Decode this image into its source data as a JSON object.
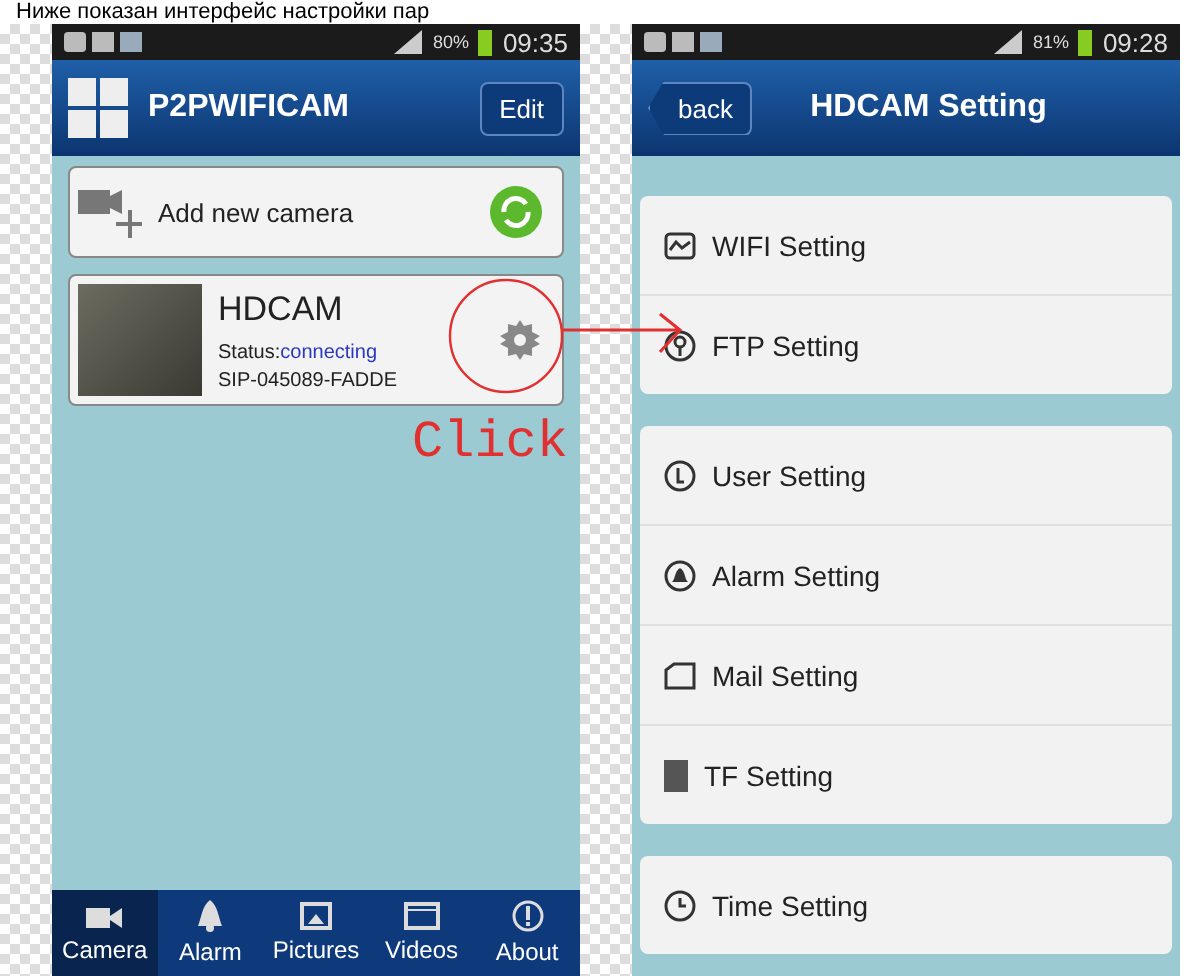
{
  "caption": "Ниже показан интерфейс настройки пар",
  "left": {
    "status": {
      "battery": "80%",
      "time": "09:35"
    },
    "title": "P2PWIFICAM",
    "edit": "Edit",
    "add_camera": "Add new camera",
    "camera": {
      "name": "HDCAM",
      "status_label": "Status:",
      "status_value": "connecting",
      "id": "SIP-045089-FADDE"
    },
    "nav": [
      {
        "label": "Camera",
        "kind": "camera",
        "selected": true
      },
      {
        "label": "Alarm",
        "kind": "alarm",
        "selected": false
      },
      {
        "label": "Pictures",
        "kind": "pictures",
        "selected": false
      },
      {
        "label": "Videos",
        "kind": "videos",
        "selected": false
      },
      {
        "label": "About",
        "kind": "about",
        "selected": false
      }
    ]
  },
  "right": {
    "status": {
      "battery": "81%",
      "time": "09:28"
    },
    "back": "back",
    "title": "HDCAM  Setting",
    "groups": [
      [
        {
          "label": "WIFI Setting",
          "kind": "wifi"
        },
        {
          "label": "FTP Setting",
          "kind": "ftp"
        }
      ],
      [
        {
          "label": "User Setting",
          "kind": "user"
        },
        {
          "label": "Alarm Setting",
          "kind": "alarm"
        },
        {
          "label": "Mail Setting",
          "kind": "mail"
        },
        {
          "label": "TF Setting",
          "kind": "tf"
        }
      ],
      [
        {
          "label": "Time Setting",
          "kind": "time"
        }
      ]
    ]
  },
  "annotation": "Click"
}
